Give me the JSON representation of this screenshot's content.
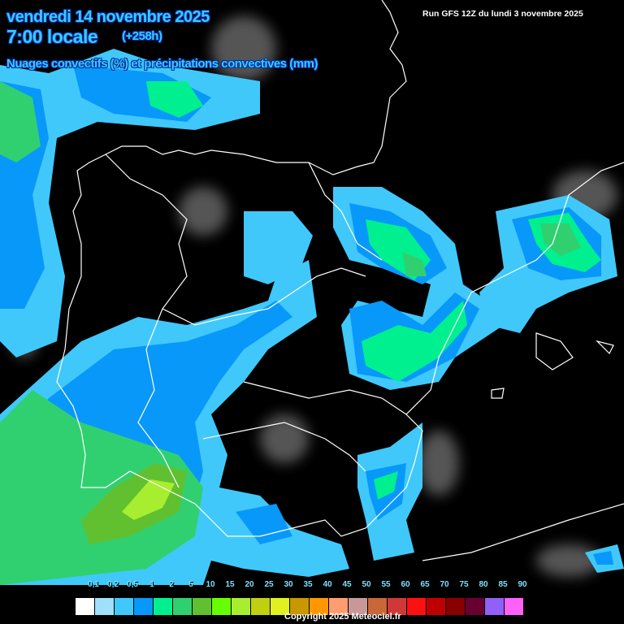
{
  "header": {
    "date": "vendredi 14 novembre 2025",
    "time": "7:00 locale",
    "lead": "(+258h)",
    "subtitle": "Nuages convectifs (%) et précipitations convectives (mm)",
    "run": "Run GFS 12Z du lundi 3 novembre 2025"
  },
  "legend": {
    "labels": [
      "0,1",
      "0,2",
      "0,5",
      "1",
      "2",
      "5",
      "10",
      "15",
      "20",
      "25",
      "30",
      "35",
      "40",
      "45",
      "50",
      "55",
      "60",
      "65",
      "70",
      "75",
      "80",
      "85",
      "90"
    ],
    "colors": [
      "#ffffff",
      "#a0e0fa",
      "#40c8fa",
      "#0898fa",
      "#00f090",
      "#30d070",
      "#60c030",
      "#66ff00",
      "#a8ee30",
      "#c0d010",
      "#e0f020",
      "#c89800",
      "#ff9800",
      "#ff9c70",
      "#c89898",
      "#c86838",
      "#d03838",
      "#ff1010",
      "#c00000",
      "#880000",
      "#680030",
      "#9060f8",
      "#ff60f8"
    ]
  },
  "footer": {
    "copyright": "Copyright 2025 Meteociel.fr"
  }
}
